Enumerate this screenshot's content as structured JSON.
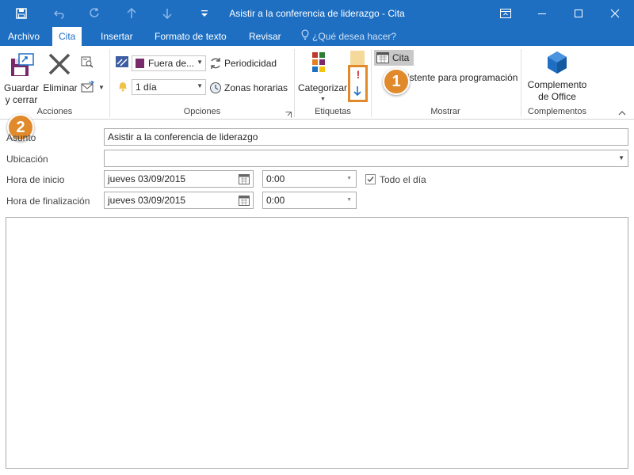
{
  "window": {
    "title": "Asistir a la conferencia de liderazgo - Cita"
  },
  "tabs": [
    {
      "label": "Archivo"
    },
    {
      "label": "Cita"
    },
    {
      "label": "Insertar"
    },
    {
      "label": "Formato de texto"
    },
    {
      "label": "Revisar"
    }
  ],
  "tell_me": "¿Qué desea hacer?",
  "ribbon": {
    "acciones": {
      "save_label_1": "Guardar",
      "save_label_2": "y cerrar",
      "delete_label": "Eliminar",
      "group_label": "Acciones"
    },
    "opciones": {
      "show_as": "Fuera de...",
      "reminder": "1 día",
      "recurrence": "Periodicidad",
      "time_zones": "Zonas horarias",
      "group_label": "Opciones"
    },
    "etiquetas": {
      "categorize": "Categorizar",
      "group_label": "Etiquetas"
    },
    "mostrar": {
      "appointment": "Cita",
      "scheduling": "Asistente para programación",
      "group_label": "Mostrar"
    },
    "complementos": {
      "office_1": "Complemento",
      "office_2": "de Office",
      "group_label": "Complementos"
    }
  },
  "callouts": [
    "1",
    "2"
  ],
  "form": {
    "subject_label": "Asunto",
    "subject_value": "Asistir a la conferencia de liderazgo",
    "location_label": "Ubicación",
    "location_value": "",
    "start_label": "Hora de inicio",
    "start_date": "jueves 03/09/2015",
    "start_time": "0:00",
    "all_day_label": "Todo el día",
    "all_day_checked": true,
    "end_label": "Hora de finalización",
    "end_date": "jueves 03/09/2015",
    "end_time": "0:00"
  },
  "colors": {
    "title_bar": "#1e6fc2",
    "callout": "#e08a2c",
    "show_as_swatch": "#7a2a6a",
    "office_icon": "#1e6fc2"
  }
}
